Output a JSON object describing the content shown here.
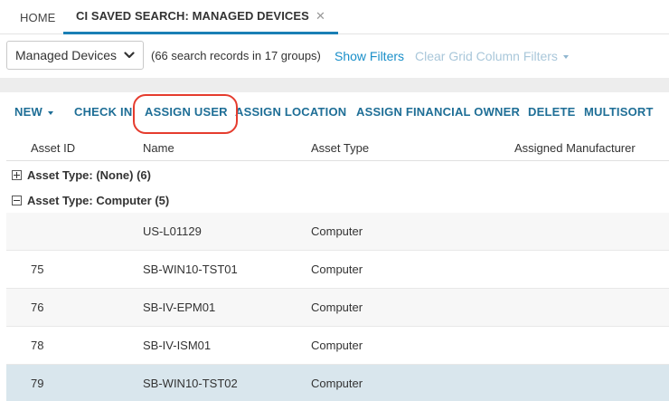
{
  "tabs": [
    {
      "label": "HOME"
    },
    {
      "label": "CI SAVED SEARCH: MANAGED DEVICES",
      "close": "✕"
    }
  ],
  "filter": {
    "selected": "Managed Devices",
    "records_text": "(66 search records in 17 groups)",
    "show_filters": "Show Filters",
    "clear_filters": "Clear Grid Column Filters"
  },
  "toolbar": {
    "new": "NEW",
    "check_in": "CHECK IN",
    "assign_user": "ASSIGN USER",
    "assign_location": "ASSIGN LOCATION",
    "assign_financial_owner": "ASSIGN FINANCIAL OWNER",
    "delete": "DELETE",
    "multisort": "MULTISORT"
  },
  "columns": [
    "Asset ID",
    "Name",
    "Asset Type",
    "Assigned Manufacturer"
  ],
  "groups": [
    {
      "label": "Asset Type: (None) (6)",
      "expanded": false
    },
    {
      "label": "Asset Type: Computer (5)",
      "expanded": true
    }
  ],
  "rows": [
    {
      "asset_id": "",
      "name": "US-L01129",
      "asset_type": "Computer",
      "manufacturer": ""
    },
    {
      "asset_id": "75",
      "name": "SB-WIN10-TST01",
      "asset_type": "Computer",
      "manufacturer": ""
    },
    {
      "asset_id": "76",
      "name": "SB-IV-EPM01",
      "asset_type": "Computer",
      "manufacturer": ""
    },
    {
      "asset_id": "78",
      "name": "SB-IV-ISM01",
      "asset_type": "Computer",
      "manufacturer": ""
    },
    {
      "asset_id": "79",
      "name": "SB-WIN10-TST02",
      "asset_type": "Computer",
      "manufacturer": ""
    }
  ],
  "colors": {
    "accent": "#1e6e96",
    "link": "#1a8fc9",
    "highlight_ring": "#e53c2e",
    "selected_row": "#d9e6ed"
  }
}
